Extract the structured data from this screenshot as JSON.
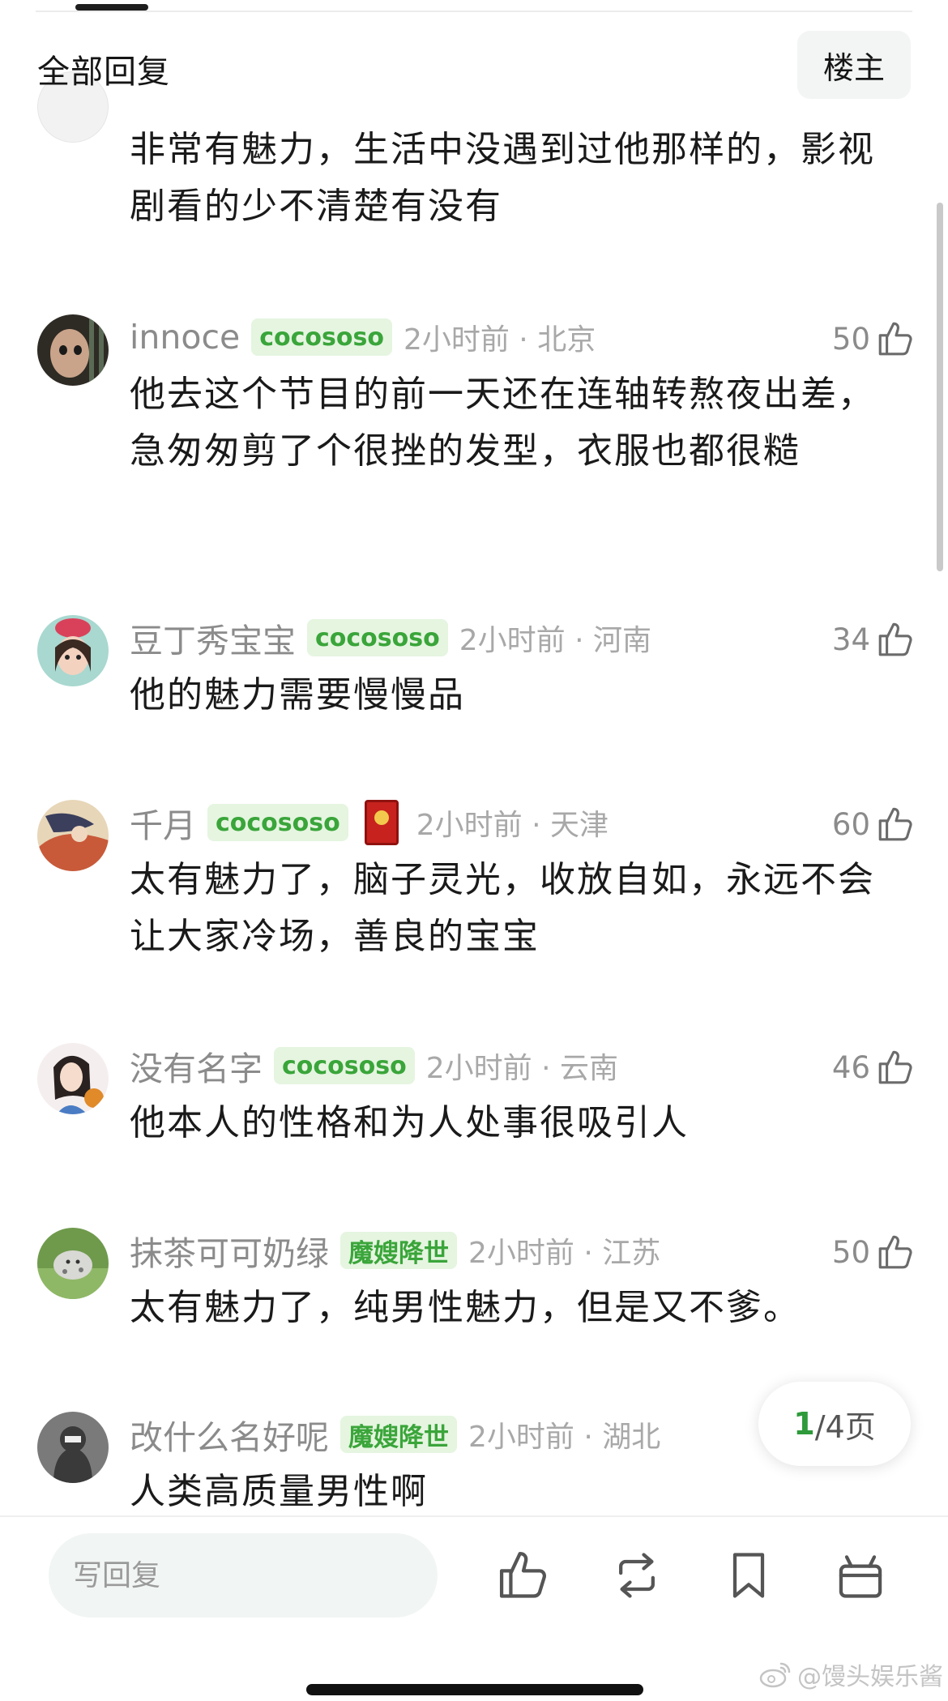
{
  "header": {
    "title": "全部回复",
    "op_button": "楼主"
  },
  "comments": [
    {
      "content": "非常有魅力，生活中没遇到过他那样的，影视剧看的少不清楚有没有"
    },
    {
      "username": "innoce",
      "badge": "cocososo",
      "time": "2小时前 · 北京",
      "likes": "50",
      "content": "他去这个节目的前一天还在连轴转熬夜出差，急匆匆剪了个很挫的发型，衣服也都很糙"
    },
    {
      "username": "豆丁秀宝宝",
      "badge": "cocososo",
      "time": "2小时前 · 河南",
      "likes": "34",
      "content": "他的魅力需要慢慢品"
    },
    {
      "username": "千月",
      "badge": "cocososo",
      "time": "2小时前 · 天津",
      "likes": "60",
      "content": "太有魅力了，脑子灵光，收放自如，永远不会让大家冷场，善良的宝宝"
    },
    {
      "username": "没有名字",
      "badge": "cocososo",
      "time": "2小时前 · 云南",
      "likes": "46",
      "content": "他本人的性格和为人处事很吸引人"
    },
    {
      "username": "抹茶可可奶绿",
      "badge": "魔嫂降世",
      "time": "2小时前 · 江苏",
      "likes": "50",
      "content": "太有魅力了，纯男性魅力，但是又不爹。"
    },
    {
      "username": "改什么名好呢",
      "badge": "魔嫂降世",
      "time": "2小时前 · 湖北",
      "content": "人类高质量男性啊"
    }
  ],
  "pager": {
    "current": "1",
    "total_text": "/4页"
  },
  "bottom_bar": {
    "reply_placeholder": "写回复",
    "icons": [
      "like-icon",
      "repost-icon",
      "bookmark-icon",
      "gift-icon"
    ]
  },
  "watermark": {
    "text": "@馒头娱乐酱"
  },
  "colors": {
    "accent_green": "#3aa53a",
    "badge_bg": "#e5f5e0",
    "meta_gray": "#8b8b8b",
    "time_gray": "#a8a8a8"
  }
}
